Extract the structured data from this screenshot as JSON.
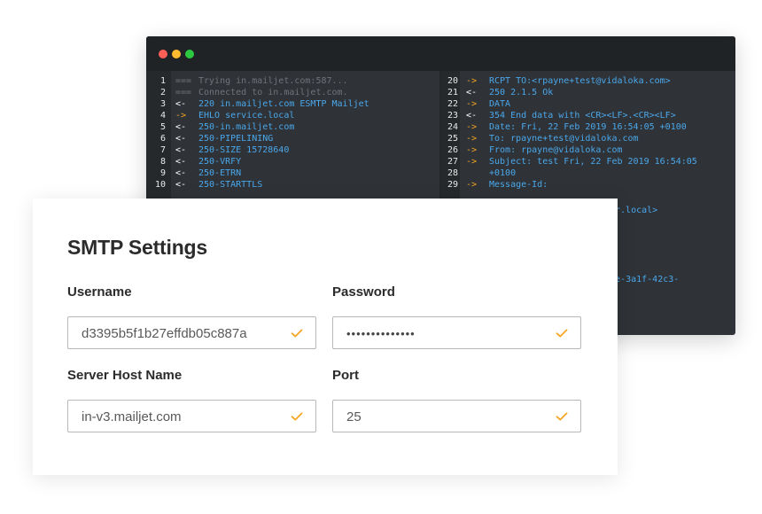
{
  "terminal": {
    "left_lines": [
      {
        "num": "1",
        "arrow": "===",
        "text": "Trying in.mailjet.com:587...",
        "kind": "dim"
      },
      {
        "num": "2",
        "arrow": "===",
        "text": "Connected to in.mailjet.com.",
        "kind": "dim"
      },
      {
        "num": "3",
        "arrow": "<-",
        "text": "220 in.mailjet.com ESMTP Mailjet",
        "kind": "in"
      },
      {
        "num": "4",
        "arrow": "->",
        "text": "EHLO service.local",
        "kind": "out"
      },
      {
        "num": "5",
        "arrow": "<-",
        "text": "250-in.mailjet.com",
        "kind": "in"
      },
      {
        "num": "6",
        "arrow": "<-",
        "text": "250-PIPELINING",
        "kind": "in"
      },
      {
        "num": "7",
        "arrow": "<-",
        "text": "250-SIZE 15728640",
        "kind": "in"
      },
      {
        "num": "8",
        "arrow": "<-",
        "text": "250-VRFY",
        "kind": "in"
      },
      {
        "num": "9",
        "arrow": "<-",
        "text": "250-ETRN",
        "kind": "in"
      },
      {
        "num": "10",
        "arrow": "<-",
        "text": "250-STARTTLS",
        "kind": "in"
      }
    ],
    "right_lines": [
      {
        "num": "20",
        "arrow": "->",
        "text": "RCPT TO:<rpayne+test@vidaloka.com>",
        "kind": "out"
      },
      {
        "num": "21",
        "arrow": "<-",
        "text": "250 2.1.5 Ok",
        "kind": "in"
      },
      {
        "num": "22",
        "arrow": "->",
        "text": "DATA",
        "kind": "out"
      },
      {
        "num": "23",
        "arrow": "<-",
        "text": "354 End data with <CR><LF>.<CR><LF>",
        "kind": "in"
      },
      {
        "num": "24",
        "arrow": "->",
        "text": "Date: Fri, 22 Feb 2019 16:54:05 +0100",
        "kind": "out"
      },
      {
        "num": "25",
        "arrow": "->",
        "text": "To: rpayne+test@vidaloka.com",
        "kind": "out"
      },
      {
        "num": "26",
        "arrow": "->",
        "text": "From: rpayne@vidaloka.com",
        "kind": "out"
      },
      {
        "num": "27",
        "arrow": "->",
        "text": "Subject: test Fri, 22 Feb 2019 16:54:05",
        "kind": "out"
      },
      {
        "num": "28",
        "arrow": "",
        "text": "+0100",
        "kind": "out"
      },
      {
        "num": "29",
        "arrow": "->",
        "text": "Message-Id:",
        "kind": "out"
      }
    ],
    "peek": {
      "line1": "er.local>",
      "line2": "4ee-3a1f-42c3-"
    }
  },
  "smtp": {
    "title": "SMTP Settings",
    "username": {
      "label": "Username",
      "value": "d3395b5f1b27effdb05c887a"
    },
    "password": {
      "label": "Password",
      "value": "••••••••••••••"
    },
    "host": {
      "label": "Server Host Name",
      "value": "in-v3.mailjet.com"
    },
    "port": {
      "label": "Port",
      "value": "25"
    },
    "check_color": "#f5a623"
  }
}
